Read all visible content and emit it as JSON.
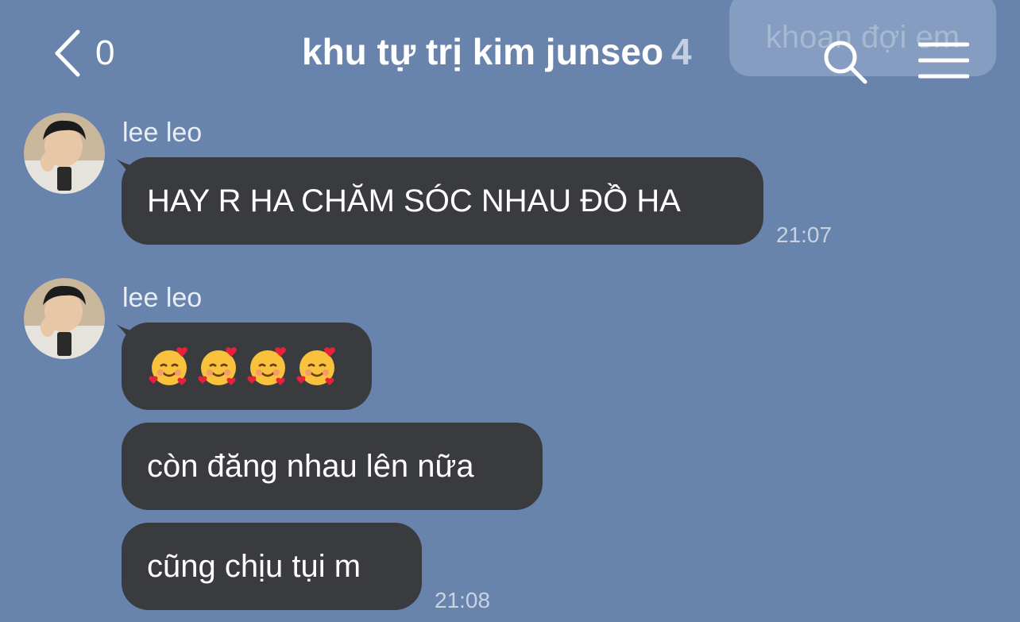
{
  "ghost_bubble": {
    "text": "khoan đợi em"
  },
  "header": {
    "back_count": "0",
    "title": "khu tự trị kim junseo",
    "member_count": "4"
  },
  "messages": [
    {
      "sender": "lee leo",
      "text": "HAY R HA CHĂM SÓC NHAU ĐỒ HA",
      "time": "21:07"
    },
    {
      "sender": "lee leo",
      "emoji_count": 4,
      "text_b": "còn đăng nhau lên nữa",
      "text_c": "cũng chịu tụi m",
      "time": "21:08"
    }
  ],
  "colors": {
    "background": "#6884ad",
    "bubble": "#3a3b3f",
    "text": "#ffffff"
  },
  "icons": [
    "back-chevron-icon",
    "search-icon",
    "menu-icon",
    "smiling-face-with-hearts-icon"
  ]
}
